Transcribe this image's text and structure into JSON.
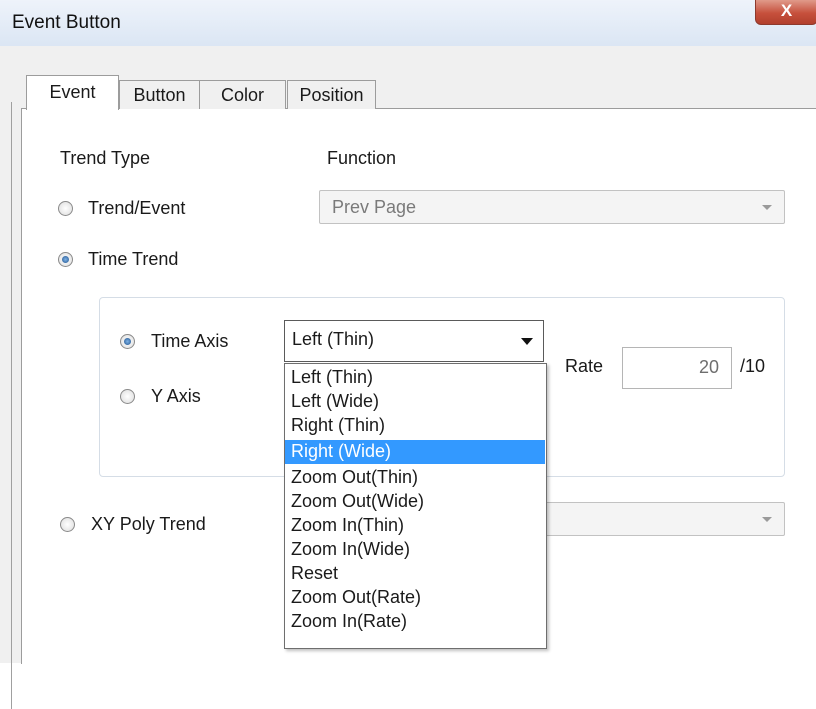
{
  "window": {
    "title": "Event Button",
    "close_label": "X"
  },
  "tabs": [
    {
      "label": "Event",
      "active": true
    },
    {
      "label": "Button",
      "active": false
    },
    {
      "label": "Color",
      "active": false
    },
    {
      "label": "Position",
      "active": false
    }
  ],
  "event": {
    "trend_type_label": "Trend Type",
    "function_label": "Function",
    "options": {
      "trend_event": "Trend/Event",
      "time_trend": "Time Trend",
      "xy_poly_trend": "XY Poly Trend"
    },
    "selected_trend_type": "Time Trend",
    "function_value": "Prev Page",
    "time_trend": {
      "time_axis_label": "Time Axis",
      "y_axis_label": "Y Axis",
      "selected_axis": "Time Axis",
      "axis_value": "Left (Thin)",
      "rate_label": "Rate",
      "rate_value": "20",
      "rate_suffix": "/10"
    },
    "axis_dropdown": {
      "items": [
        "Left (Thin)",
        "Left (Wide)",
        "Right (Thin)",
        "Right (Wide)",
        "Zoom Out(Thin)",
        "Zoom Out(Wide)",
        "Zoom In(Thin)",
        "Zoom In(Wide)",
        "Reset",
        "Zoom Out(Rate)",
        "Zoom In(Rate)"
      ],
      "highlighted": "Right (Wide)"
    }
  },
  "colors": {
    "selection": "#3399ff",
    "close_button": "#c6503c",
    "title_bar": "#dbe6f4"
  }
}
